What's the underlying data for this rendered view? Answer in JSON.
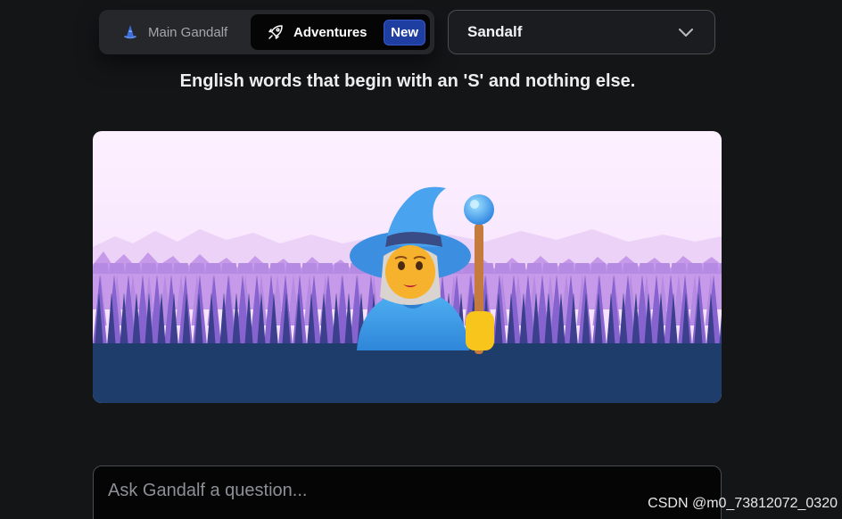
{
  "nav": {
    "tabs": [
      {
        "label": "Main Gandalf",
        "icon": "wizard-hat-icon",
        "active": false
      },
      {
        "label": "Adventures",
        "icon": "rocket-icon",
        "active": true,
        "badge": "New"
      }
    ]
  },
  "level_select": {
    "selected": "Sandalf",
    "icon": "chevron-down-icon"
  },
  "level": {
    "description": "English words that begin with an 'S' and nothing else."
  },
  "hero": {
    "image": "wizard-in-forest-illustration",
    "colors": {
      "sky": "#fbeaff",
      "mountains": "#e9c8f5",
      "forest_far": "#b27ee0",
      "forest_mid": "#7a53c3",
      "forest_near": "#3f3f8f",
      "ground": "#1f3f6c"
    }
  },
  "chat": {
    "placeholder": "Ask Gandalf a question..."
  },
  "watermark": "CSDN @m0_73812072_0320",
  "colors": {
    "background": "#141517",
    "accent_badge": "#1f3ea1"
  }
}
